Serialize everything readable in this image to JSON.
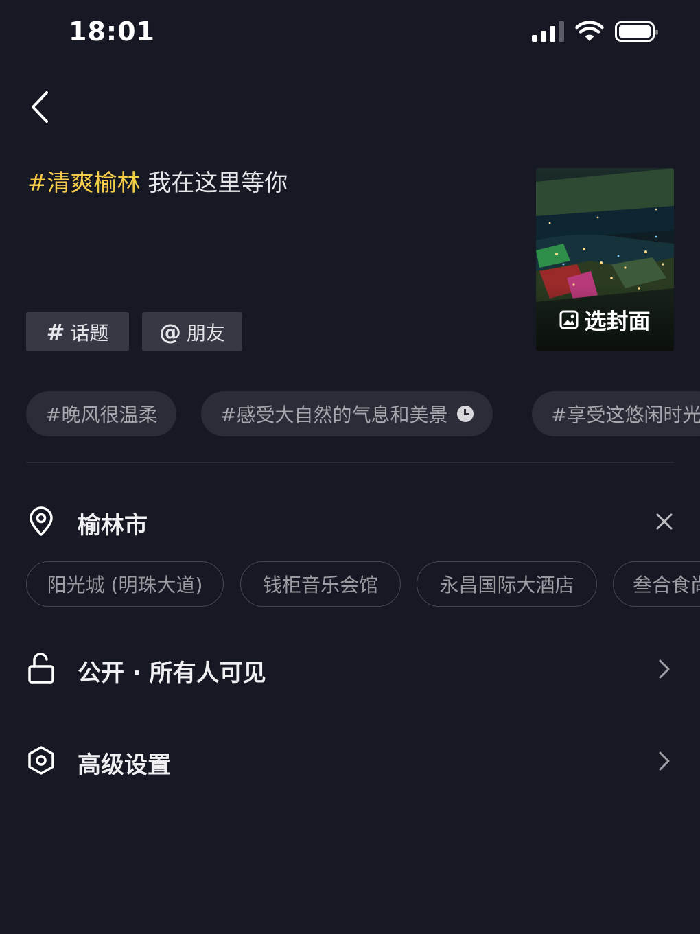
{
  "status_bar": {
    "time": "18:01",
    "icons": [
      "cellular-signal-icon",
      "wifi-icon",
      "battery-icon"
    ]
  },
  "nav": {
    "back_icon": "chevron-left-icon"
  },
  "caption": {
    "hashtag": "#清爽榆林",
    "text": " 我在这里等你"
  },
  "cover": {
    "label": "选封面",
    "icon": "image-icon"
  },
  "tag_buttons": {
    "topic": {
      "symbol": "#",
      "label": "话题"
    },
    "friend": {
      "symbol": "@",
      "label": "朋友"
    }
  },
  "hashtag_suggestions": [
    "#晚风很温柔",
    "#感受大自然的气息和美景",
    "#享受这悠闲时光"
  ],
  "location": {
    "label": "榆林市",
    "icon": "location-pin-icon",
    "clear_icon": "close-icon",
    "suggestions": [
      "阳光城 (明珠大道)",
      "钱柜音乐会馆",
      "永昌国际大酒店",
      "叁合食尚"
    ]
  },
  "visibility": {
    "label": "公开 · 所有人可见",
    "icon": "unlock-icon",
    "arrow_icon": "chevron-right-icon"
  },
  "advanced": {
    "label": "高级设置",
    "icon": "settings-hexagon-icon",
    "arrow_icon": "chevron-right-icon"
  },
  "colors": {
    "background": "#161823",
    "hashtag_accent": "#f4cc4a",
    "chip_background": "#2a2c37",
    "button_background": "#363844"
  }
}
